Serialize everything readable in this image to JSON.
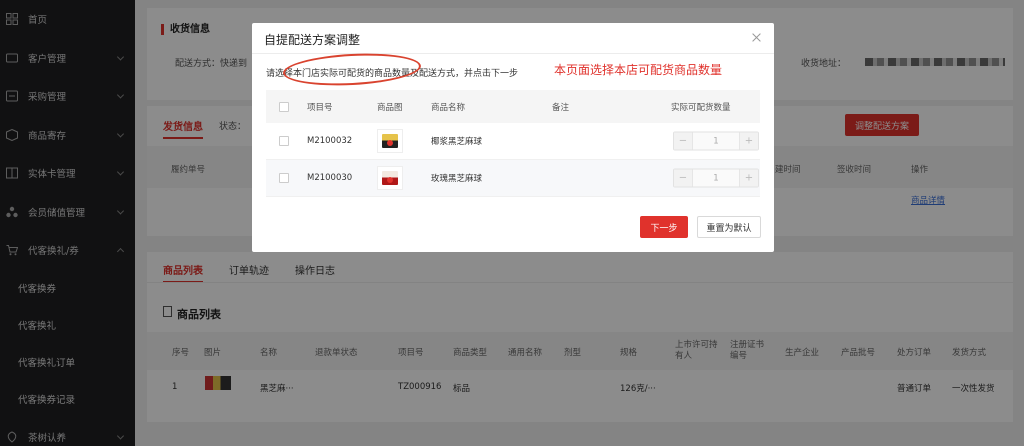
{
  "sidebar": {
    "items": [
      {
        "label": "首页",
        "icon": "grid-icon",
        "chevron": false
      },
      {
        "label": "客户管理",
        "icon": "user-icon",
        "chevron": true
      },
      {
        "label": "采购管理",
        "icon": "purchase-icon",
        "chevron": true
      },
      {
        "label": "商品寄存",
        "icon": "box-icon",
        "chevron": true
      },
      {
        "label": "实体卡管理",
        "icon": "card-icon",
        "chevron": true
      },
      {
        "label": "会员储值管理",
        "icon": "member-icon",
        "chevron": true
      },
      {
        "label": "代客换礼/券",
        "icon": "cart-icon",
        "chevron": true
      }
    ],
    "sub_items": [
      "代客换券",
      "代客换礼",
      "代客换礼订单",
      "代客换券记录"
    ],
    "last_item": {
      "label": "茶树认养",
      "icon": "leaf-icon"
    }
  },
  "page": {
    "receive_title": "收货信息",
    "delivery_method_label": "配送方式：快递到",
    "address_label": "收货地址：",
    "tab_shipping": "发货信息",
    "status_label": "状态：",
    "adjust_button": "调整配送方案",
    "col_contract": "履约单号",
    "col_ship_time": "建时间",
    "col_sign_time": "签收时间",
    "col_action": "操作",
    "detail_link": "商品详情",
    "tabs": [
      "商品列表",
      "订单轨迹",
      "操作日志"
    ],
    "product_list_title": "商品列表",
    "product_cols": [
      "序号",
      "图片",
      "名称",
      "退款单状态",
      "项目号",
      "商品类型",
      "通用名称",
      "剂型",
      "规格",
      "上市许可持有人",
      "注册证书编号",
      "生产企业",
      "产品批号",
      "处方订单",
      "发货方式"
    ],
    "product_row": {
      "index": "1",
      "name": "黑芝麻···",
      "project_no": "TZ000916",
      "type": "标品",
      "spec": "126克/···",
      "order_type": "普通订单",
      "ship_mode": "一次性发货"
    }
  },
  "modal": {
    "title": "自提配送方案调整",
    "instruction": "请选择本门店实际可配货的商品数量及配送方式，并点击下一步",
    "annotation": "本页面选择本店可配货商品数量",
    "columns": {
      "project_no": "项目号",
      "image": "商品图",
      "name": "商品名称",
      "remark": "备注",
      "qty": "实际可配货数量"
    },
    "rows": [
      {
        "project_no": "M2100032",
        "name": "椰浆黑芝麻球",
        "qty": "1",
        "alt": false
      },
      {
        "project_no": "M2100030",
        "name": "玫瑰黑芝麻球",
        "qty": "1",
        "alt": true
      }
    ],
    "next_button": "下一步",
    "reset_button": "重置为默认"
  },
  "colors": {
    "accent": "#e0322c",
    "sidebar_bg": "#1f1f21"
  }
}
